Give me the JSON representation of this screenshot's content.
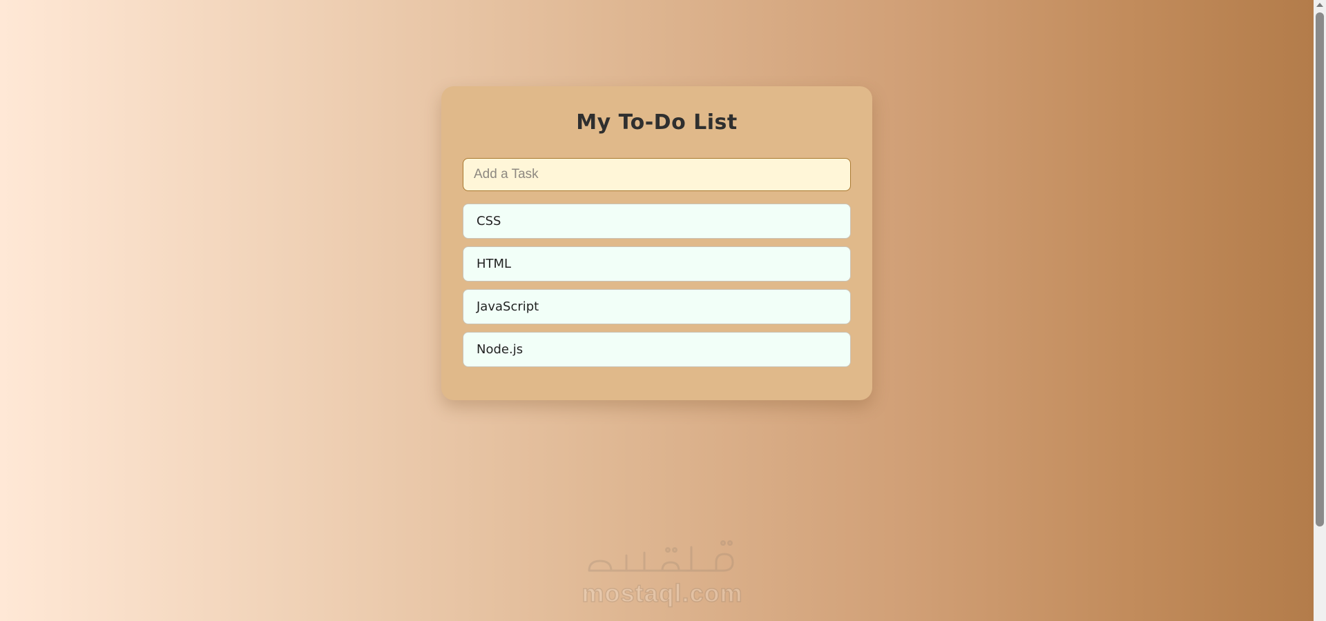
{
  "app": {
    "title": "My To-Do List"
  },
  "input": {
    "placeholder": "Add a Task",
    "value": ""
  },
  "tasks": [
    {
      "label": "CSS"
    },
    {
      "label": "HTML"
    },
    {
      "label": "JavaScript"
    },
    {
      "label": "Node.js"
    }
  ],
  "watermark": {
    "logo_text": "مستقل",
    "url_text": "mostaql.com"
  },
  "colors": {
    "card_bg": "#e0b98a",
    "input_bg": "#fff6d8",
    "task_bg": "#f2fff8",
    "title_text": "#2f2f2f"
  }
}
